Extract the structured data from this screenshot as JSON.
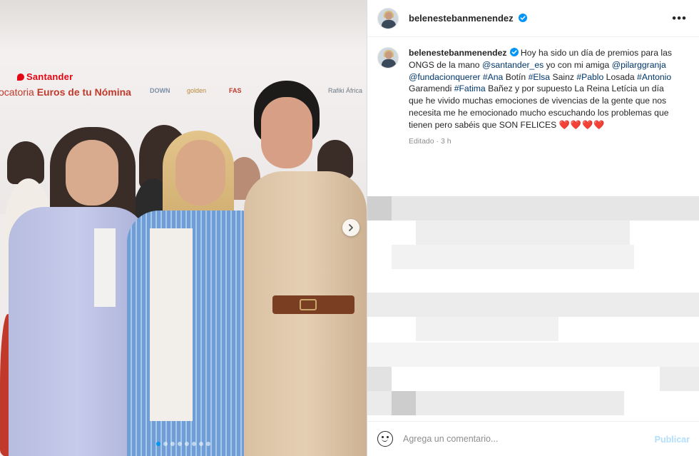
{
  "banner": {
    "brand": "Santander",
    "slogan_prefix": "ocatoria",
    "slogan_bold": "Euros de tu Nómina",
    "partners": [
      "DOWN",
      "golden",
      "FAS",
      "Rafiki África"
    ]
  },
  "carousel": {
    "slide_count": 8,
    "active_index": 0,
    "next_icon": "chevron-right-icon"
  },
  "header": {
    "username": "belenestebanmenendez",
    "verified_icon": "verified-badge-icon",
    "more_icon": "more-options-icon",
    "more_label": "•••"
  },
  "caption": {
    "username": "belenestebanmenendez",
    "text_1": " Hoy ha sido un día de premios para las ONGS de la mano ",
    "mention_1": "@santander_es",
    "text_2": " yo con mi amiga ",
    "mention_2": "@pilarggranja",
    "text_3": " ",
    "mention_3": "@fundacionquerer",
    "text_4": " ",
    "hashtag_1": "#Ana",
    "text_5": " Botín ",
    "hashtag_2": "#Elsa",
    "text_6": " Sainz ",
    "hashtag_3": "#Pablo",
    "text_7": " Losada ",
    "hashtag_4": "#Antonio",
    "text_8": " Garamendi ",
    "hashtag_5": "#Fatima",
    "text_9": " Bañez y por supuesto La Reina Letícia un día que he vivido muchas emociones de vivencias de la gente que nos necesita me he emocionado mucho escuchando los problemas que tienen pero sabéis que SON FELICES ",
    "hearts": "❤️❤️❤️❤️",
    "edited": "Editado",
    "time": "3 h"
  },
  "footer": {
    "emoji_icon": "emoji-smiley-icon",
    "comment_placeholder": "Agrega un comentario...",
    "publish_label": "Publicar"
  },
  "colors": {
    "link": "#00376b",
    "verified": "#0095f6",
    "publish_disabled": "#b2dffc",
    "santander_red": "#e30613"
  }
}
